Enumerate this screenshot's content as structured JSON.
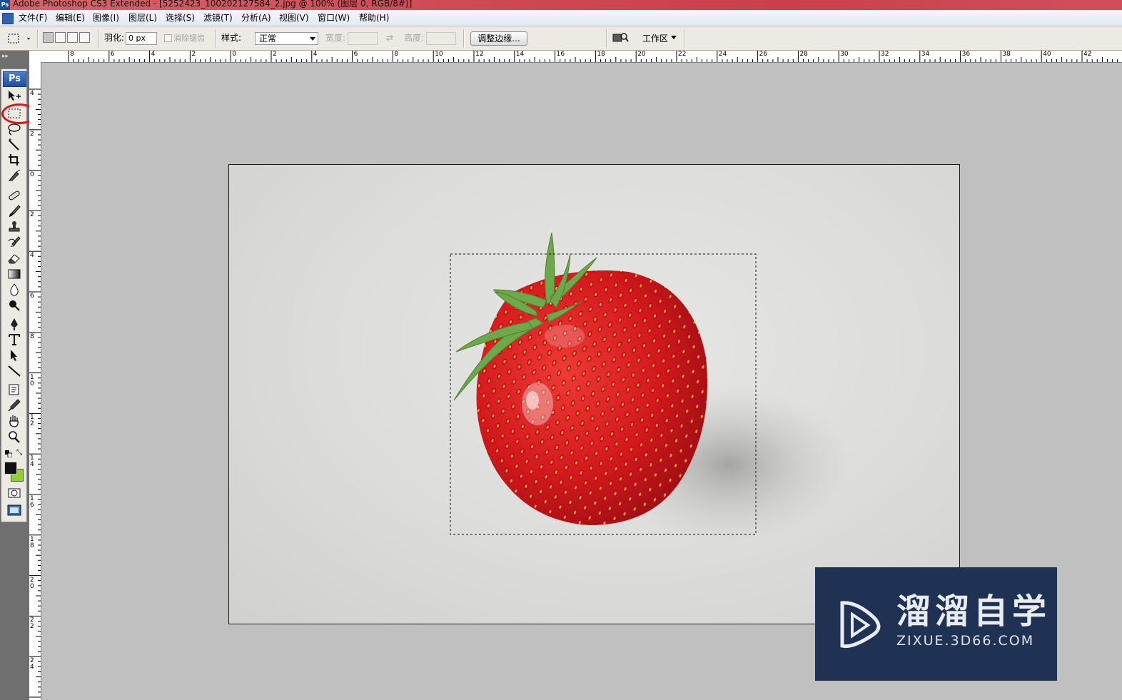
{
  "window": {
    "title": "Adobe Photoshop CS3 Extended - [5252423_100202127584_2.jpg @ 100% (图层 0, RGB/8#)]"
  },
  "menu": [
    "文件(F)",
    "编辑(E)",
    "图像(I)",
    "图层(L)",
    "选择(S)",
    "滤镜(T)",
    "分析(A)",
    "视图(V)",
    "窗口(W)",
    "帮助(H)"
  ],
  "options": {
    "feather_label": "羽化:",
    "feather_value": "0 px",
    "antialias_label": "消除锯齿",
    "style_label": "样式:",
    "style_value": "正常",
    "width_label": "宽度:",
    "height_label": "高度:",
    "refine_edge_button": "调整边缘...",
    "workspace_label": "工作区"
  },
  "ruler_h_labels": [
    "8",
    "6",
    "4",
    "2",
    "0",
    "2",
    "4",
    "6",
    "8",
    "10",
    "12",
    "14",
    "16",
    "18",
    "20",
    "22",
    "24",
    "26",
    "28",
    "30",
    "32",
    "34",
    "36",
    "38",
    "40",
    "42"
  ],
  "ruler_v_labels": [
    "4",
    "2",
    "0",
    "2",
    "4",
    "6",
    "8",
    "10",
    "12",
    "14",
    "16",
    "18",
    "20",
    "22",
    "24"
  ],
  "toolbox": {
    "logo": "Ps",
    "tools": [
      "move-tool",
      "rectangular-marquee-tool",
      "lasso-tool",
      "magic-wand-tool",
      "crop-tool",
      "slice-tool",
      "healing-brush-tool",
      "brush-tool",
      "clone-stamp-tool",
      "history-brush-tool",
      "eraser-tool",
      "gradient-tool",
      "blur-tool",
      "dodge-tool",
      "pen-tool",
      "type-tool",
      "path-selection-tool",
      "line-tool",
      "notes-tool",
      "eyedropper-tool",
      "hand-tool",
      "zoom-tool"
    ],
    "foreground_color": "#111111",
    "background_color": "#8fd12a",
    "highlighted_tool": "rectangular-marquee-tool"
  },
  "canvas": {
    "image_subject": "strawberry",
    "has_selection": true
  },
  "watermark": {
    "name": "溜溜自学",
    "url": "ZIXUE.3D66.COM"
  }
}
